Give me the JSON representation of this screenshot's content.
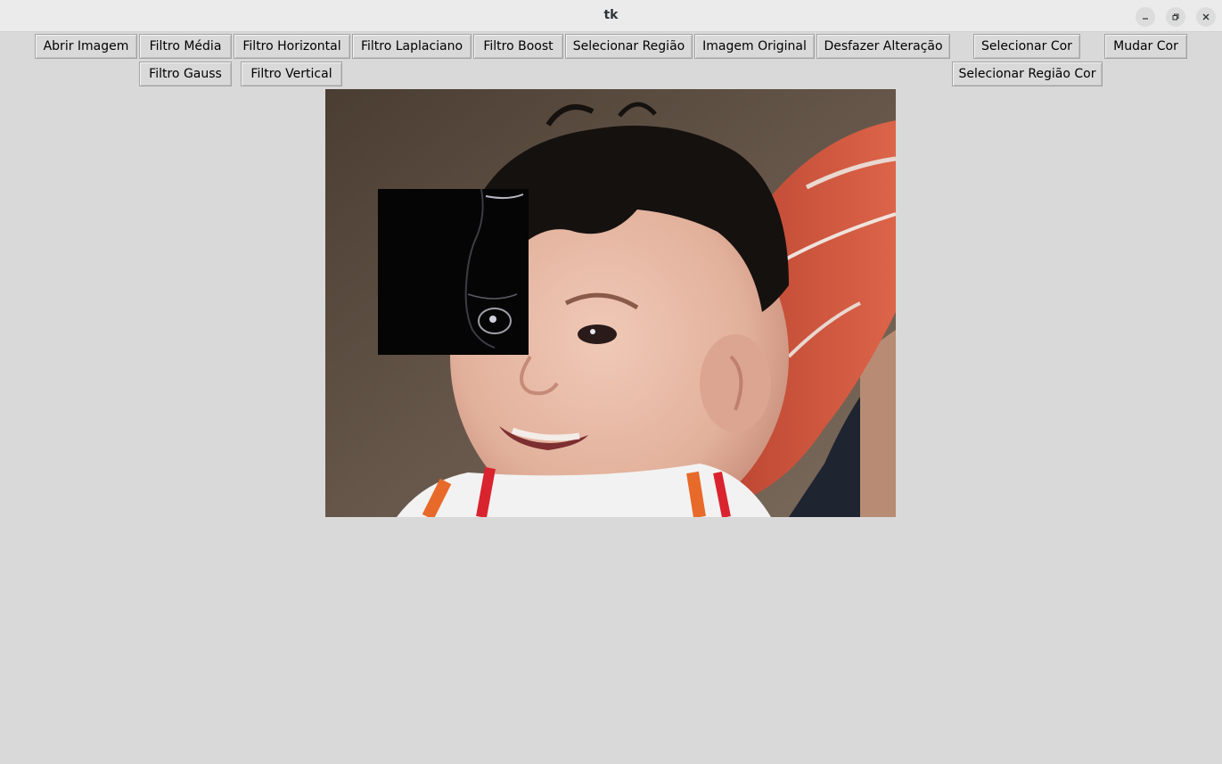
{
  "window": {
    "title": "tk",
    "controls": [
      "minimize-icon",
      "maximize-icon",
      "close-icon"
    ]
  },
  "toolbar": {
    "row1": {
      "abrir_imagem": "Abrir Imagem",
      "filtro_media": "Filtro Média",
      "filtro_horizontal": "Filtro Horizontal",
      "filtro_laplaciano": "Filtro Laplaciano",
      "filtro_boost": "Filtro Boost",
      "selecionar_regiao": "Selecionar Região",
      "imagem_original": "Imagem Original",
      "desfazer_alteracao": "Desfazer Alteração",
      "selecionar_cor": "Selecionar Cor",
      "mudar_cor": "Mudar Cor"
    },
    "row2": {
      "filtro_gauss": "Filtro Gauss",
      "filtro_vertical": "Filtro Vertical",
      "selecionar_regiao_cor": "Selecionar Região Cor"
    }
  },
  "canvas": {
    "content": "photo of smiling baby with a filtered (dark edge-detected) rectangular region",
    "colors": {
      "background_wall": "#5d4e3f",
      "hair": "#15110f",
      "skin": "#e6b7a3",
      "sweater": "#d2553c",
      "filtered_region": "#050505"
    }
  }
}
